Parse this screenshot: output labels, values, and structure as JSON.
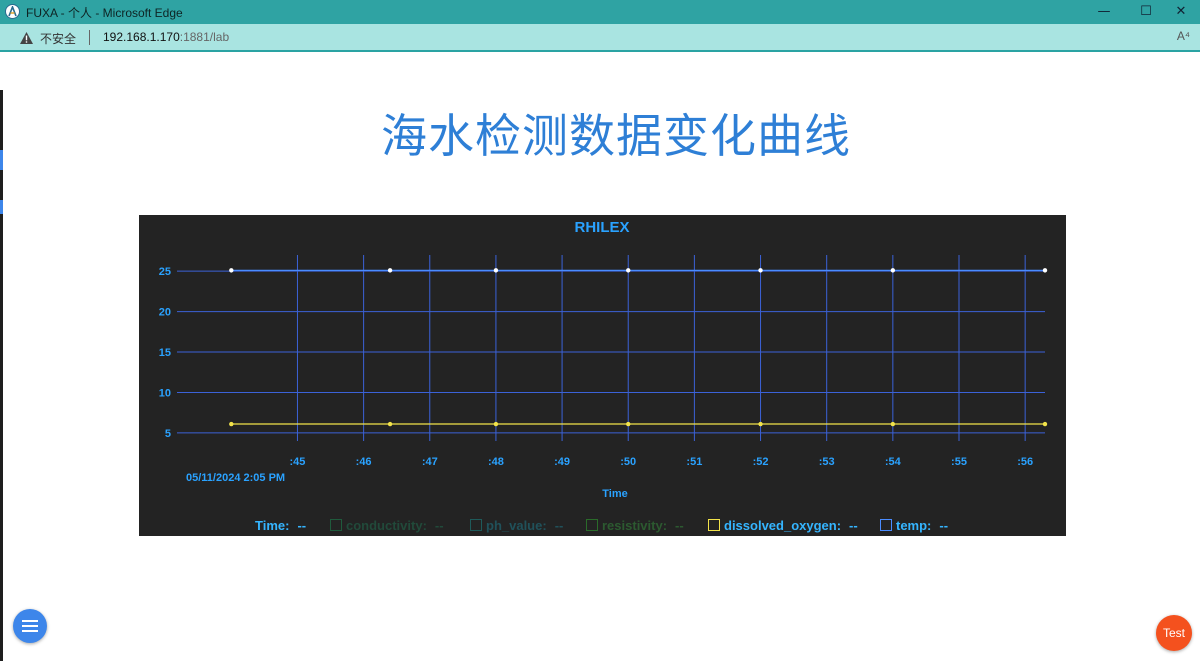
{
  "window": {
    "title": "FUXA - 个人 - Microsoft Edge",
    "minimize_glyph": "—",
    "maximize_glyph": "☐",
    "close_glyph": "✕"
  },
  "address_bar": {
    "security_label": "不安全",
    "url_host": "192.168.1.170",
    "url_rest": ":1881/lab",
    "read_aloud_label": "A⁴"
  },
  "page": {
    "title": "海水检测数据变化曲线"
  },
  "chart_data": {
    "type": "line",
    "title": "RHILEX",
    "xlabel": "Time",
    "ylabel": "",
    "x_ticks": [
      ":45",
      ":46",
      ":47",
      ":48",
      ":49",
      ":50",
      ":51",
      ":52",
      ":53",
      ":54",
      ":55",
      ":56"
    ],
    "x_start_label": "05/11/2024 2:05 PM",
    "y_ticks": [
      5,
      10,
      15,
      20,
      25
    ],
    "ylim": [
      4,
      27
    ],
    "x": [
      "05/11/2024 2:05:44",
      "05/11/2024 2:05:46.4",
      "05/11/2024 2:05:48",
      "05/11/2024 2:05:50",
      "05/11/2024 2:05:52",
      "05/11/2024 2:05:54",
      "05/11/2024 2:05:56.3"
    ],
    "series": [
      {
        "name": "temp",
        "values": [
          25.1,
          25.1,
          25.1,
          25.1,
          25.1,
          25.1,
          25.1
        ],
        "color": "#4a8cff"
      },
      {
        "name": "dissolved_oxygen",
        "values": [
          6.1,
          6.1,
          6.1,
          6.1,
          6.1,
          6.1,
          6.1
        ],
        "color": "#f2e34a"
      }
    ],
    "grid": true,
    "legend_position": "bottom"
  },
  "legend": {
    "time_label": "Time:",
    "time_value": "--",
    "items": [
      {
        "label": "conductivity:",
        "value": "--",
        "color": "#1f5a3c",
        "text_color": "#214a3a"
      },
      {
        "label": "ph_value:",
        "value": "--",
        "color": "#1e5a5a",
        "text_color": "#20515a"
      },
      {
        "label": "resistivity:",
        "value": "--",
        "color": "#2a6b2a",
        "text_color": "#2c5a30"
      },
      {
        "label": "dissolved_oxygen:",
        "value": "--",
        "color": "#f2e34a",
        "text_color": "#35b5ff"
      },
      {
        "label": "temp:",
        "value": "--",
        "color": "#4a8cff",
        "text_color": "#35b5ff"
      }
    ]
  },
  "buttons": {
    "test_label": "Test"
  },
  "colors": {
    "accent": "#2e7fd6",
    "chart_bg": "#232323",
    "chart_text": "#2aa2ff",
    "grid": "#3b62d8",
    "titlebar": "#2fa3a3",
    "addressbar": "#a9e4e1"
  }
}
